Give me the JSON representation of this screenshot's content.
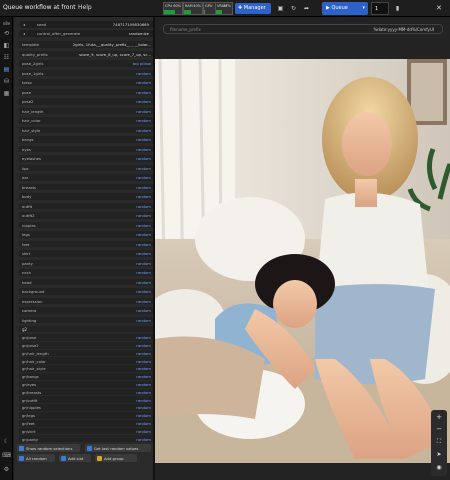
{
  "header": {
    "title": "Queue workflow at front",
    "help": "Help",
    "meters": [
      {
        "label": "CPU",
        "value": "60%",
        "fill": 0.6
      },
      {
        "label": "RAM",
        "value": "40%",
        "fill": 0.4
      },
      {
        "label": "GPU",
        "value": "8%",
        "fill": 0.08
      },
      {
        "label": "VRAM",
        "value": "37%",
        "fill": 0.37
      }
    ],
    "manager_label": "Manager",
    "queue_label": "Queue",
    "batch_count": "1"
  },
  "sidebar_icons": [
    "nodes-icon",
    "history-icon",
    "queue-icon",
    "library-icon",
    "models-icon",
    "workflow-icon",
    "settings-icon"
  ],
  "sidebar_label": "n8e",
  "panel": {
    "seed_label": "seed",
    "seed_value": "748717109830669",
    "control_label": "control_after_generate",
    "control_value": "randomize",
    "rows": [
      {
        "k": "template",
        "v": "2girls, 1futa,__quality_prefix__ _ __kolor..."
      },
      {
        "k": "quality_prefix",
        "v": "score_9, score_8_up, score_7_up, sc..."
      },
      {
        "k": "pose_2girls",
        "v": "top pillow"
      },
      {
        "k": "pose_1girls",
        "v": "random"
      },
      {
        "k": "torso",
        "v": "random"
      },
      {
        "k": "pose",
        "v": "random"
      },
      {
        "k": "pose2",
        "v": "random"
      },
      {
        "k": "hair_length",
        "v": "random"
      },
      {
        "k": "hair_color",
        "v": "random"
      },
      {
        "k": "hair_style",
        "v": "random"
      },
      {
        "k": "bangs",
        "v": "random"
      },
      {
        "k": "eyes",
        "v": "random"
      },
      {
        "k": "eyelashes",
        "v": "random"
      },
      {
        "k": "lips",
        "v": "random"
      },
      {
        "k": "ear",
        "v": "random"
      },
      {
        "k": "breasts",
        "v": "random"
      },
      {
        "k": "body",
        "v": "random"
      },
      {
        "k": "outfit",
        "v": "random"
      },
      {
        "k": "outfit2",
        "v": "random"
      },
      {
        "k": "nipples",
        "v": "random"
      },
      {
        "k": "legs",
        "v": "random"
      },
      {
        "k": "feet",
        "v": "random"
      },
      {
        "k": "skirt",
        "v": "random"
      },
      {
        "k": "panty",
        "v": "random"
      },
      {
        "k": "neck",
        "v": "random"
      },
      {
        "k": "head",
        "v": "random"
      },
      {
        "k": "background",
        "v": "random"
      },
      {
        "k": "expression",
        "v": "random"
      },
      {
        "k": "camera",
        "v": "random"
      },
      {
        "k": "lighting",
        "v": "random"
      }
    ],
    "section_label": "g2",
    "rows2": [
      {
        "k": "gr/pose",
        "v": "random"
      },
      {
        "k": "gr/pose2",
        "v": "random"
      },
      {
        "k": "gr/hair_length",
        "v": "random"
      },
      {
        "k": "gr/hair_color",
        "v": "random"
      },
      {
        "k": "gr/hair_style",
        "v": "random"
      },
      {
        "k": "gr/bangs",
        "v": "random"
      },
      {
        "k": "gr/eyes",
        "v": "random"
      },
      {
        "k": "gr/breasts",
        "v": "random"
      },
      {
        "k": "gr/outfit",
        "v": "random"
      },
      {
        "k": "gr/nipples",
        "v": "random"
      },
      {
        "k": "gr/legs",
        "v": "random"
      },
      {
        "k": "gr/feet",
        "v": "random"
      },
      {
        "k": "gr/skirt",
        "v": "random"
      },
      {
        "k": "gr/panty",
        "v": "random"
      }
    ],
    "buttons": {
      "show_random": "Show random selections",
      "get_last": "Get last random values",
      "all_random": "All random",
      "add_slot": "Add slot",
      "add_group": "Add group"
    }
  },
  "canvas": {
    "filename_prefix_label": "filename_prefix",
    "filename_prefix_value": "%date:yyyy-MM-dd%/ComfyUI"
  },
  "colors": {
    "accent": "#2d62c9",
    "link_value": "#6aa0ff",
    "panel_bg": "#2a2a2a"
  }
}
